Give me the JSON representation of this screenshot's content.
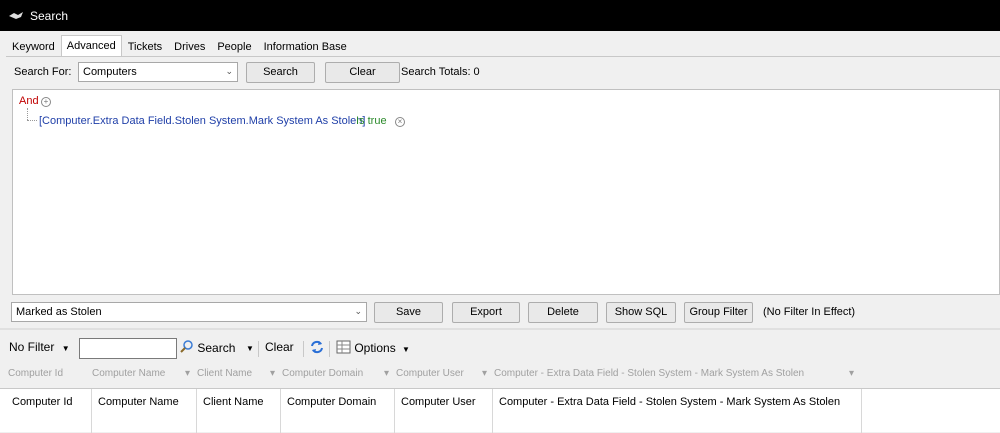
{
  "window": {
    "title": "Search"
  },
  "tabs": [
    "Keyword",
    "Advanced",
    "Tickets",
    "Drives",
    "People",
    "Information Base"
  ],
  "search": {
    "label": "Search For:",
    "selected": "Computers",
    "search_button": "Search",
    "clear_button": "Clear",
    "totals": "Search Totals: 0"
  },
  "query": {
    "operator": "And",
    "condition_field": "[Computer.Extra Data Field.Stolen System.Mark System As Stolen]",
    "condition_op": "Is true"
  },
  "saved_filter": {
    "selected": "Marked as Stolen",
    "buttons": {
      "save": "Save",
      "export": "Export",
      "delete": "Delete",
      "show_sql": "Show SQL",
      "group_filter": "Group Filter"
    },
    "status": "(No Filter In Effect)"
  },
  "toolbar": {
    "no_filter": "No Filter",
    "filter_value": "",
    "search": "Search",
    "clear": "Clear",
    "options": "Options"
  },
  "filter_headers": [
    "Computer Id",
    "Computer Name",
    "Client Name",
    "Computer Domain",
    "Computer User",
    "Computer - Extra Data Field - Stolen System - Mark System As Stolen"
  ],
  "columns": [
    "Computer Id",
    "Computer Name",
    "Client Name",
    "Computer Domain",
    "Computer User",
    "Computer - Extra Data Field - Stolen System - Mark System As Stolen"
  ]
}
